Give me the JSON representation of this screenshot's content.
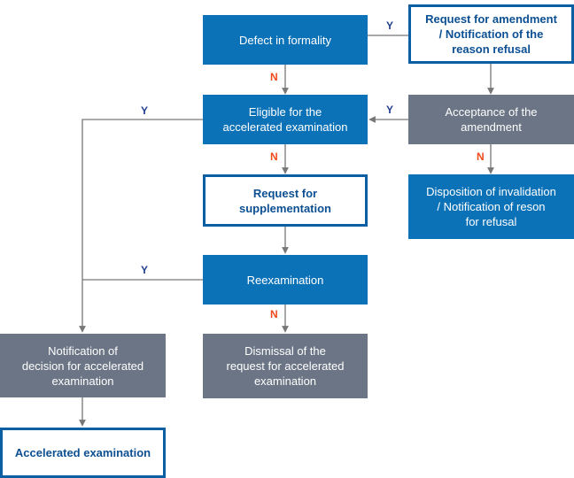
{
  "diagram": {
    "type": "flowchart",
    "colors": {
      "primary_blue": "#0c72b8",
      "gray": "#6b7585",
      "outline_blue": "#0c5fa3",
      "yes_label": "#1f3f8f",
      "no_label": "#f04a1b",
      "connector": "#777777"
    },
    "nodes": {
      "defect": "Defect in formality",
      "request_amendment": "Request for amendment\n/ Notification of the\nreason refusal",
      "eligible": "Eligible for the\naccelerated examination",
      "acceptance": "Acceptance of the\namendment",
      "request_supplementation": "Request for\nsupplementation",
      "disposition": "Disposition of invalidation\n/ Notification of reson\nfor refusal",
      "reexamination": "Reexamination",
      "notification_decision": "Notification of\ndecision for accelerated\nexamination",
      "dismissal": "Dismissal of the\nrequest for accelerated\nexamination",
      "accelerated_exam": "Accelerated examination"
    },
    "edges": [
      {
        "from": "defect",
        "to": "request_amendment",
        "label": "Y"
      },
      {
        "from": "defect",
        "to": "eligible",
        "label": "N"
      },
      {
        "from": "request_amendment",
        "to": "acceptance",
        "label": ""
      },
      {
        "from": "acceptance",
        "to": "eligible",
        "label": "Y"
      },
      {
        "from": "acceptance",
        "to": "disposition",
        "label": "N"
      },
      {
        "from": "eligible",
        "to": "notification_decision",
        "label": "Y"
      },
      {
        "from": "eligible",
        "to": "request_supplementation",
        "label": "N"
      },
      {
        "from": "request_supplementation",
        "to": "reexamination",
        "label": ""
      },
      {
        "from": "reexamination",
        "to": "notification_decision",
        "label": "Y"
      },
      {
        "from": "reexamination",
        "to": "dismissal",
        "label": "N"
      },
      {
        "from": "notification_decision",
        "to": "accelerated_exam",
        "label": ""
      }
    ],
    "labels": {
      "yes": "Y",
      "no": "N"
    }
  }
}
